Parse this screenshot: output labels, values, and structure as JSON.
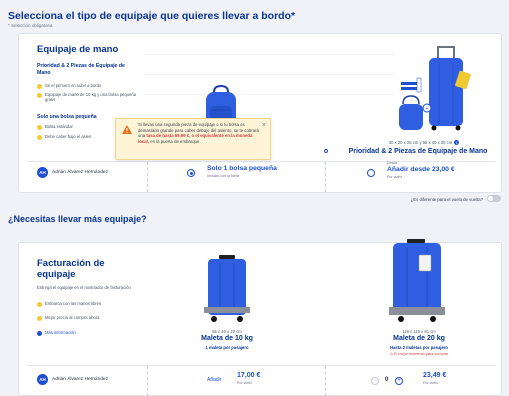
{
  "header": {
    "title": "Selecciona el tipo de equipaje que quieres llevar a bordo*",
    "required_note": "* Selección obligatoria"
  },
  "cabin": {
    "section_title": "Equipaje de mano",
    "option1_title": "Prioridad & 2 Piezas de Equipaje de Mano",
    "option1_bullets": [
      "Sé el primero en subir a bordo",
      "Equipaje de mano de 10 kg y una bolsa pequeña gratis"
    ],
    "option2_title": "Solo una bolsa pequeña",
    "option2_bullets": [
      "Bolsa estándar",
      "Debe caber bajo el asien"
    ],
    "bag_size": "40 x 20 x 25 cm",
    "priority_size": "40 x 20 x 25 cm y 55 x 40 x 20 cm",
    "priority_label": "Prioridad & 2 Piezas de Equipaje de Mano",
    "priority_prefix": "o",
    "warning_pre": "Si llevas una segunda pieza de equipaje o si tu bolsa es demasiado grande para caber debajo del asiento, se te cobrará una ",
    "warning_highlight": "tasa de hasta 69,99 €, o el equivalente en la moneda local,",
    "warning_post": " en la puerta de embarque.",
    "warning_close": "×"
  },
  "passenger1": {
    "initials": "AH",
    "name": "Adrián Álvarez Hernández",
    "choice1_main": "Solo 1 bolsa pequeña",
    "choice1_sub": "Incluido con la tarifa",
    "choice2_prefix": "Desde",
    "choice2_main": "Añadir desde 23,00 €",
    "choice2_sub": "Por vuelo"
  },
  "return_toggle": {
    "label": "¿Es diferente para el vuelo de vuelta?"
  },
  "more_title": "¿Necesitas llevar más equipaje?",
  "checked": {
    "section_title": "Facturación de equipaje",
    "description": "Entrega el equipaje en el mostrador de facturación",
    "bullets": [
      "Embarca con las manos libres",
      "Mejor precio al compra ahora"
    ],
    "more_info": "Más información",
    "bag10_size": "55 x 40 x 20 cm",
    "bag10_label": "Maleta de 10 kg",
    "bag10_note": "1 maleta por pasajero",
    "bag20_size": "119 x 119 x 81 cm",
    "bag20_label": "Maleta de 20 kg",
    "bag20_note": "Hasta 2 maletas por pasajero",
    "bag20_red": "El mejor momento para comprar"
  },
  "passenger2": {
    "initials": "AH",
    "name": "Adrián Álvarez Hernández",
    "add_label": "Añadir",
    "price10": "17,00 €",
    "per10": "Por vuelo",
    "qty": "0",
    "minus": "−",
    "plus": "+",
    "price20": "23,49 €",
    "per20": "Por vuelo"
  },
  "colors": {
    "brand_blue": "#073590",
    "accent_blue": "#1f4fd1",
    "yellow": "#f1c933",
    "warning_bg": "#fff4d6",
    "red": "#d23a3a"
  }
}
